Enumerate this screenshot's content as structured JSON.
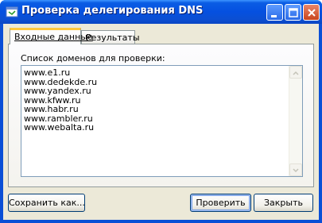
{
  "window": {
    "title": "Проверка делегирования DNS"
  },
  "tabs": [
    {
      "label": "Входные данные",
      "active": true
    },
    {
      "label": "Результаты",
      "active": false
    }
  ],
  "input_tab": {
    "list_label": "Список доменов для проверки:",
    "domains": [
      "www.e1.ru",
      "www.dedekde.ru",
      "www.yandex.ru",
      "www.kfww.ru",
      "www.habr.ru",
      "www.rambler.ru",
      "www.webalta.ru"
    ]
  },
  "buttons": {
    "save_as": "Сохранить как...",
    "check": "Проверить",
    "close": "Закрыть"
  },
  "titlebar_buttons": [
    "minimize-icon",
    "maximize-icon",
    "close-icon"
  ]
}
